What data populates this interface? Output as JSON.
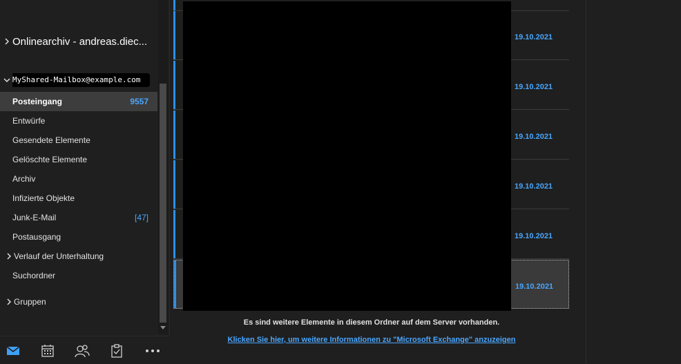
{
  "accounts": {
    "online_archive": "Onlinearchiv - andreas.diec...",
    "shared_mailbox": "MyShared-Mailbox@example.com"
  },
  "folders": [
    {
      "label": "Posteingang",
      "count": "9557"
    },
    {
      "label": "Entwürfe",
      "count": ""
    },
    {
      "label": "Gesendete Elemente",
      "count": ""
    },
    {
      "label": "Gelöschte Elemente",
      "count": ""
    },
    {
      "label": "Archiv",
      "count": ""
    },
    {
      "label": "Infizierte Objekte",
      "count": ""
    },
    {
      "label": "Junk-E-Mail",
      "count": "[47]"
    },
    {
      "label": "Postausgang",
      "count": ""
    },
    {
      "label": "Verlauf der Unterhaltung",
      "count": ""
    },
    {
      "label": "Suchordner",
      "count": ""
    },
    {
      "label": "Gruppen",
      "count": ""
    }
  ],
  "messages": [
    {
      "date": "19.10.2021"
    },
    {
      "date": "19.10.2021"
    },
    {
      "date": "19.10.2021"
    },
    {
      "date": "19.10.2021"
    },
    {
      "date": "19.10.2021"
    },
    {
      "date": "19.10.2021"
    }
  ],
  "footer": {
    "more_items": "Es sind weitere Elemente in diesem Ordner auf dem Server vorhanden.",
    "exchange_link": "Klicken Sie hier, um weitere Informationen zu \"Microsoft Exchange\" anzuzeigen"
  },
  "nav": [
    "mail-icon",
    "calendar-icon",
    "people-icon",
    "tasks-icon",
    "more-icon"
  ],
  "colors": {
    "accent": "#4aa7ff",
    "unread_bar": "#2e8fe8",
    "background": "#1f1f1f"
  }
}
